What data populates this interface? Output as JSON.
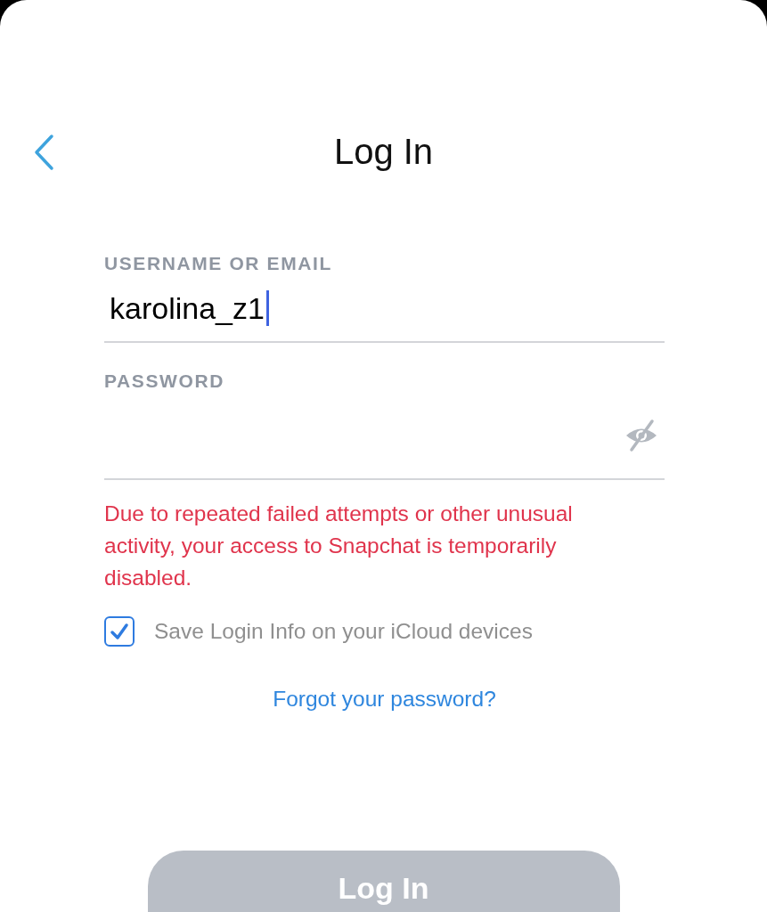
{
  "header": {
    "title": "Log In"
  },
  "username": {
    "label": "USERNAME OR EMAIL",
    "value": "karolina_z1",
    "focused": true
  },
  "password": {
    "label": "PASSWORD",
    "revealed": false
  },
  "error": "Due to repeated failed attempts or other unusual activity, your access to Snapchat is temporarily disabled.",
  "save_login": {
    "label": "Save Login Info on your iCloud devices",
    "checked": true
  },
  "forgot_link": "Forgot your password?",
  "login_button": {
    "label": "Log In",
    "disabled": true
  }
}
